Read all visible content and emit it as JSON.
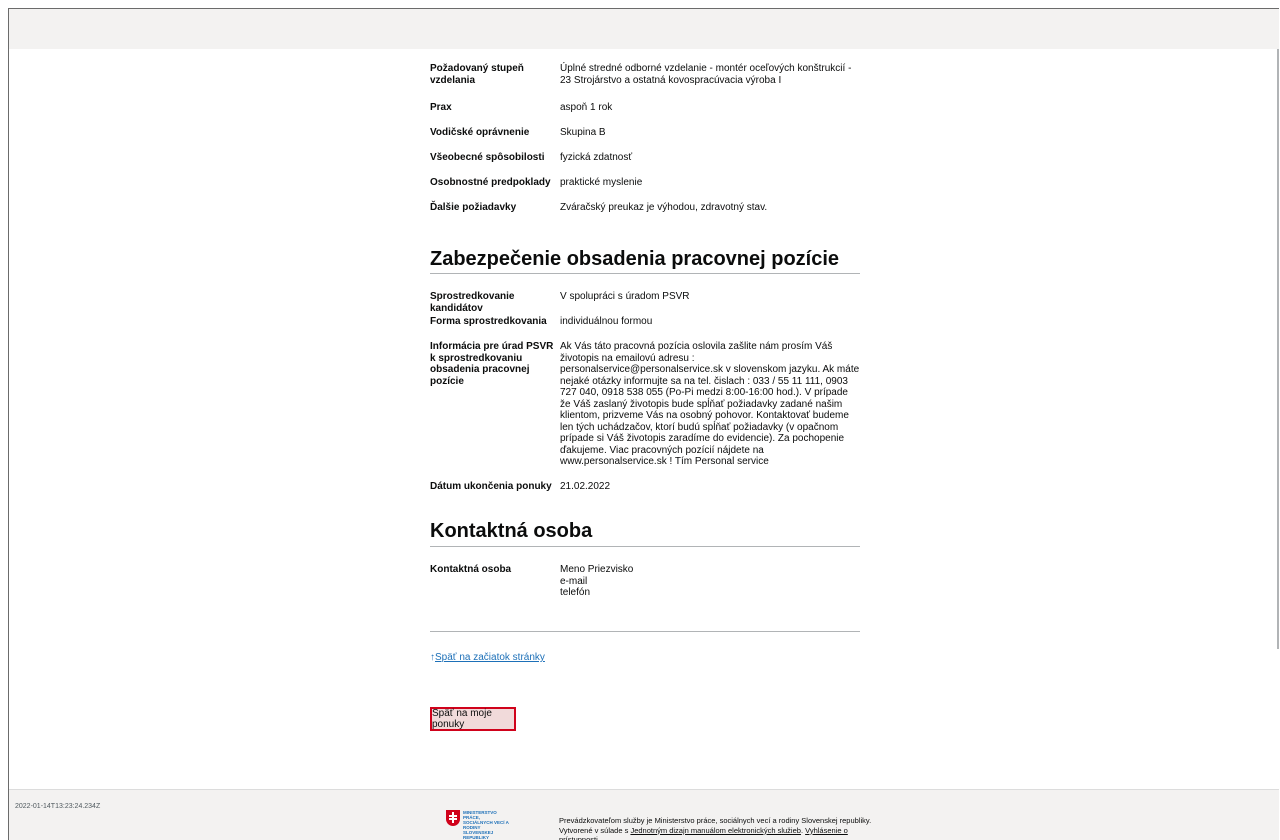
{
  "requirements": [
    {
      "label": "Požadovaný stupeň vzdelania",
      "value": "Úplné stredné odborné vzdelanie - montér oceľových konštrukcií - 23 Strojárstvo a ostatná kovospracúvacia výroba I"
    },
    {
      "label": "Prax",
      "value": "aspoň 1 rok"
    },
    {
      "label": "Vodičské oprávnenie",
      "value": "Skupina B"
    },
    {
      "label": "Všeobecné spôsobilosti",
      "value": "fyzická zdatnosť"
    },
    {
      "label": "Osobnostné predpoklady",
      "value": "praktické myslenie"
    },
    {
      "label": "Ďalšie požiadavky",
      "value": "Zváračský preukaz je výhodou, zdravotný stav."
    }
  ],
  "section_staffing": {
    "title": "Zabezpečenie obsadenia pracovnej pozície",
    "rows": [
      {
        "label": "Sprostredkovanie kandidátov",
        "value": "V spolupráci s úradom PSVR"
      },
      {
        "label": "Forma sprostredkovania",
        "value": "individuálnou formou"
      },
      {
        "label": "Informácia pre úrad PSVR k sprostredkovaniu obsadenia pracovnej pozície",
        "value": "Ak Vás táto pracovná pozícia oslovila zašlite nám prosím Váš životopis na emailovú adresu : personalservice@personalservice.sk v slovenskom jazyku. Ak máte nejaké otázky informujte sa na tel. čislach : 033 / 55 11 111, 0903 727 040, 0918 538 055 (Po-Pi medzi 8:00-16:00 hod.). V prípade že Váš zaslaný životopis bude spĺňať požiadavky zadané našim klientom, prizveme Vás na osobný pohovor. Kontaktovať budeme len tých uchádzačov, ktorí budú spĺňať požiadavky (v opačnom prípade si Váš životopis zaradíme do evidencie). Za pochopenie ďakujeme. Viac pracovných pozícií nájdete na www.personalservice.sk ! Tím Personal service"
      },
      {
        "label": "Dátum ukončenia ponuky",
        "value": "21.02.2022"
      }
    ]
  },
  "section_contact": {
    "title": "Kontaktná osoba",
    "label": "Kontaktná osoba",
    "name": "Meno Priezvisko",
    "email": "e-mail",
    "phone": "telefón"
  },
  "back_to_top": "Späť na začiatok stránky",
  "back_button": "Späť na moje ponuky",
  "footer": {
    "timestamp": "2022-01-14T13:23:24.234Z",
    "logo_text": "MINISTERSTVO PRÁCE, SOCIÁLNYCH VECÍ A RODINY SLOVENSKEJ REPUBLIKY",
    "text_prefix": "Prevádzkovateľom služby je Ministerstvo práce, sociálnych vecí a rodiny Slovenskej republiky. Vytvorené v súlade s ",
    "link1": "Jednotným dizajn manuálom elektronických služieb",
    "text_mid": ". ",
    "link2": "Vyhlásenie o prístupnosti",
    "text_suffix": "."
  },
  "colors": {
    "accent": "#1d70b8",
    "highlight_border": "#d0021b",
    "footer_bg": "#f3f2f1"
  }
}
